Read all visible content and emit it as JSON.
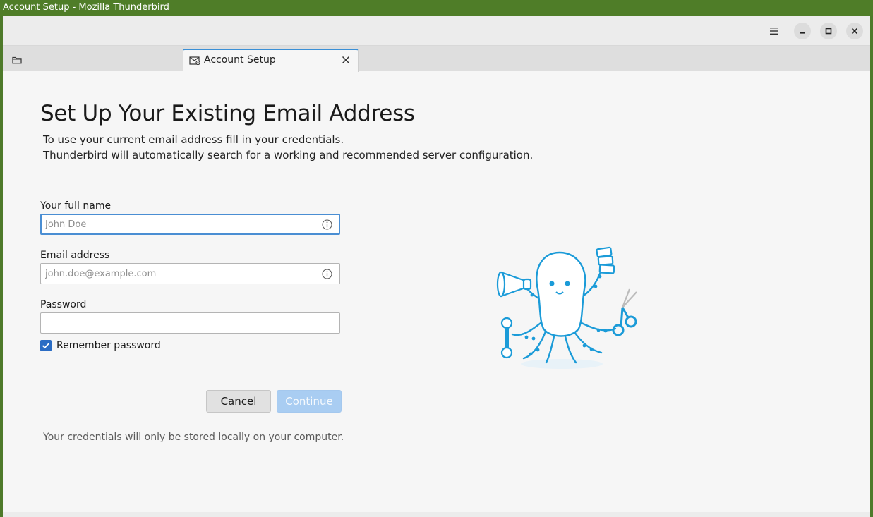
{
  "window": {
    "title": "Account Setup - Mozilla Thunderbird"
  },
  "toolbar": {
    "icons": [
      "hamburger-menu-icon",
      "minimize-icon",
      "maximize-icon",
      "close-icon"
    ]
  },
  "tabs": [
    {
      "icon": "folder-icon",
      "label": ""
    },
    {
      "icon": "account-setup-icon",
      "label": "Account Setup",
      "active": true
    }
  ],
  "setup": {
    "title": "Set Up Your Existing Email Address",
    "desc_line1": "To use your current email address fill in your credentials.",
    "desc_line2": "Thunderbird will automatically search for a working and recommended server configuration.",
    "fullname_label": "Your full name",
    "fullname_placeholder": "John Doe",
    "fullname_value": "",
    "email_label": "Email address",
    "email_placeholder": "john.doe@example.com",
    "email_value": "",
    "password_label": "Password",
    "password_value": "",
    "remember_label": "Remember password",
    "remember_checked": true,
    "cancel_label": "Cancel",
    "continue_label": "Continue",
    "footnote": "Your credentials will only be stored locally on your computer."
  },
  "colors": {
    "titlebar": "#4f7d28",
    "accent": "#2a6cc4",
    "focus_border": "#4a8ed3",
    "continue_disabled": "#a9cdf2",
    "illustration_blue": "#1b9bd8"
  }
}
